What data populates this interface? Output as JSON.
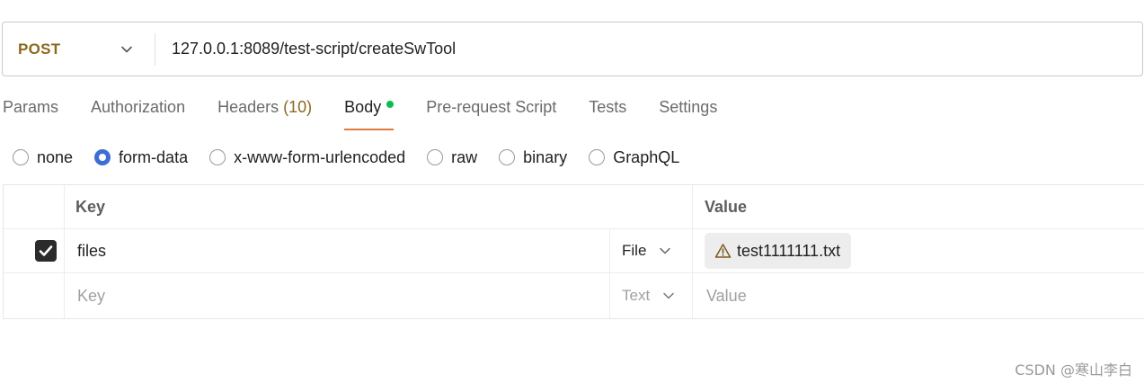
{
  "request": {
    "method": "POST",
    "url": "127.0.0.1:8089/test-script/createSwTool"
  },
  "tabs": [
    {
      "label": "Params",
      "active": false
    },
    {
      "label": "Authorization",
      "active": false
    },
    {
      "label": "Headers",
      "count": "(10)",
      "active": false
    },
    {
      "label": "Body",
      "active": true,
      "indicator": "green-dot"
    },
    {
      "label": "Pre-request Script",
      "active": false
    },
    {
      "label": "Tests",
      "active": false
    },
    {
      "label": "Settings",
      "active": false
    }
  ],
  "body_types": [
    {
      "label": "none",
      "selected": false
    },
    {
      "label": "form-data",
      "selected": true
    },
    {
      "label": "x-www-form-urlencoded",
      "selected": false
    },
    {
      "label": "raw",
      "selected": false
    },
    {
      "label": "binary",
      "selected": false
    },
    {
      "label": "GraphQL",
      "selected": false
    }
  ],
  "table": {
    "headers": {
      "key": "Key",
      "value": "Value"
    },
    "rows": [
      {
        "checked": true,
        "key": "files",
        "type": "File",
        "value": "test1111111.txt",
        "value_icon": "warning-icon"
      }
    ],
    "empty_row": {
      "key_placeholder": "Key",
      "type": "Text",
      "value_placeholder": "Value"
    }
  },
  "watermark": "CSDN @寒山李白",
  "colors": {
    "method": "#8a6a1e",
    "active_tab_underline": "#e07a3f",
    "body_dot": "#0cbb52",
    "radio_selected": "#3b6fd6",
    "checkbox": "#2b2b2b"
  }
}
